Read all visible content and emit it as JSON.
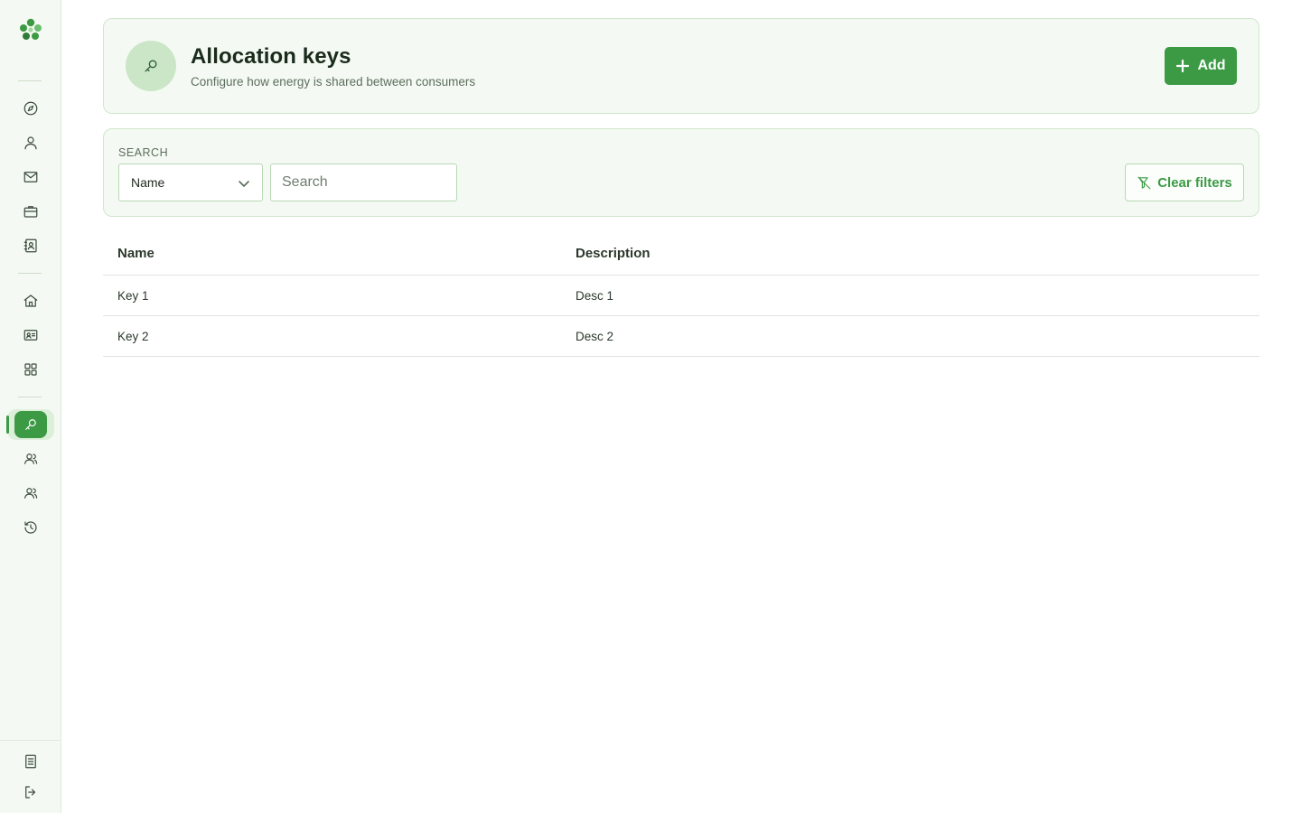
{
  "header": {
    "title": "Allocation keys",
    "subtitle": "Configure how energy is shared between consumers",
    "add_label": "Add",
    "icon": "key-icon"
  },
  "filters": {
    "label": "SEARCH",
    "field_selected": "Name",
    "search_placeholder": "Search",
    "search_value": "",
    "clear_label": "Clear filters"
  },
  "table": {
    "columns": [
      "Name",
      "Description"
    ],
    "rows": [
      [
        "Key 1",
        "Desc 1"
      ],
      [
        "Key 2",
        "Desc 2"
      ]
    ]
  },
  "sidebar": {
    "items": [
      {
        "icon": "compass-icon"
      },
      {
        "icon": "user-icon"
      },
      {
        "icon": "mail-icon"
      },
      {
        "icon": "briefcase-icon"
      },
      {
        "icon": "contact-book-icon"
      },
      {
        "icon": "home-icon"
      },
      {
        "icon": "id-card-icon"
      },
      {
        "icon": "grid-icon"
      },
      {
        "icon": "key-icon",
        "active": true
      },
      {
        "icon": "users-icon"
      },
      {
        "icon": "users-icon"
      },
      {
        "icon": "history-icon"
      }
    ],
    "bottom": [
      {
        "icon": "document-icon"
      },
      {
        "icon": "logout-icon"
      }
    ]
  },
  "colors": {
    "accent": "#3c9a45",
    "panel_bg": "#f4faf3",
    "panel_border": "#cfe6cc"
  }
}
